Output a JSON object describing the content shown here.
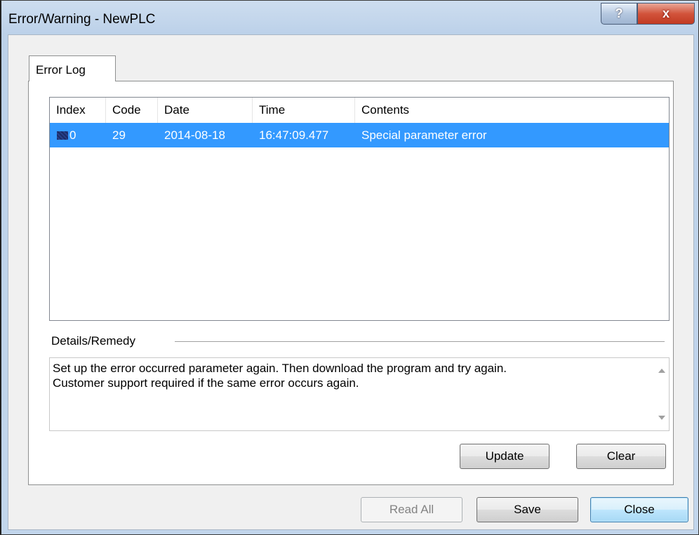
{
  "window": {
    "title": "Error/Warning - NewPLC",
    "help_label": "?",
    "close_label": "x"
  },
  "tabs": [
    {
      "label": "Error Log",
      "selected": true
    }
  ],
  "error_log": {
    "columns": [
      "Index",
      "Code",
      "Date",
      "Time",
      "Contents"
    ],
    "rows": [
      {
        "index": "0",
        "code": "29",
        "date": "2014-08-18",
        "time": "16:47:09.477",
        "contents": "Special parameter error",
        "selected": true
      }
    ]
  },
  "details": {
    "label": "Details/Remedy",
    "lines": [
      "Set up the error occurred parameter again. Then download the program and try again.",
      "Customer support required if the same error occurs again."
    ]
  },
  "panel_buttons": {
    "update": "Update",
    "clear": "Clear"
  },
  "footer_buttons": {
    "read_all": "Read All",
    "save": "Save",
    "close": "Close"
  },
  "colors": {
    "selection": "#3399ff",
    "title_bar": "#bcd1e9",
    "close_button": "#c13a22"
  }
}
